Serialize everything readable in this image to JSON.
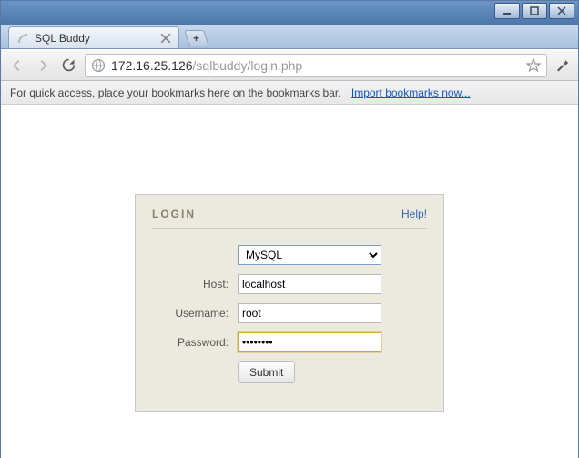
{
  "window": {
    "tab_title": "SQL Buddy"
  },
  "toolbar": {
    "url_host": "172.16.25.126",
    "url_path": "/sqlbuddy/login.php"
  },
  "bookmarks_bar": {
    "hint": "For quick access, place your bookmarks here on the bookmarks bar.",
    "import_link": "Import bookmarks now..."
  },
  "login": {
    "title": "LOGIN",
    "help": "Help!",
    "db_type": "MySQL",
    "host_label": "Host:",
    "host_value": "localhost",
    "username_label": "Username:",
    "username_value": "root",
    "password_label": "Password:",
    "password_value": "••••••••",
    "submit": "Submit"
  }
}
